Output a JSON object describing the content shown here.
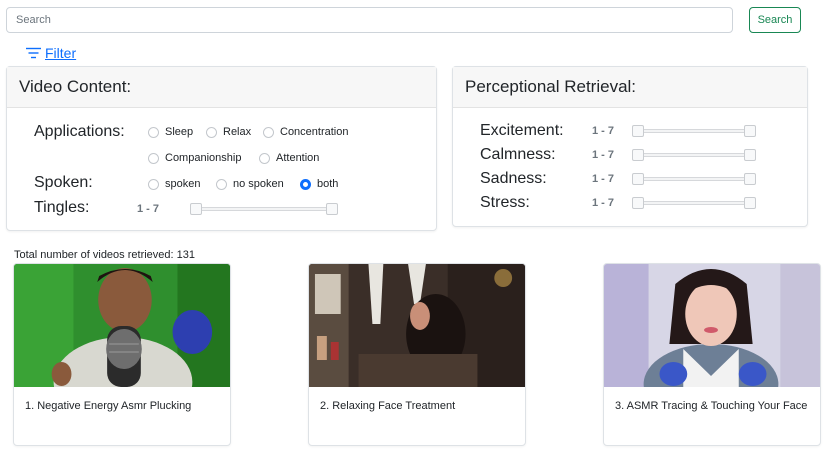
{
  "search": {
    "placeholder": "Search",
    "button_label": "Search"
  },
  "filter": {
    "label": "Filter",
    "icon": "filter-lines-icon"
  },
  "video_content": {
    "title": "Video Content:",
    "applications_label": "Applications:",
    "applications": [
      "Sleep",
      "Relax",
      "Concentration",
      "Companionship",
      "Attention"
    ],
    "spoken_label": "Spoken:",
    "spoken_options": [
      "spoken",
      "no spoken",
      "both"
    ],
    "spoken_selected": "both",
    "tingles_label": "Tingles:",
    "tingles_range": "1 - 7"
  },
  "perceptional": {
    "title": "Perceptional Retrieval:",
    "items": [
      {
        "label": "Excitement:",
        "range": "1 - 7"
      },
      {
        "label": "Calmness:",
        "range": "1 - 7"
      },
      {
        "label": "Sadness:",
        "range": "1 - 7"
      },
      {
        "label": "Stress:",
        "range": "1 - 7"
      }
    ]
  },
  "results": {
    "total_text": "Total number of videos retrieved: 131",
    "videos": [
      {
        "title": "1. Negative Energy Asmr Plucking"
      },
      {
        "title": "2. Relaxing Face Treatment"
      },
      {
        "title": "3. ASMR Tracing & Touching Your Face"
      }
    ]
  },
  "colors": {
    "accent_blue": "#0d6efd",
    "search_green": "#198754",
    "muted_text": "#6c757d"
  }
}
